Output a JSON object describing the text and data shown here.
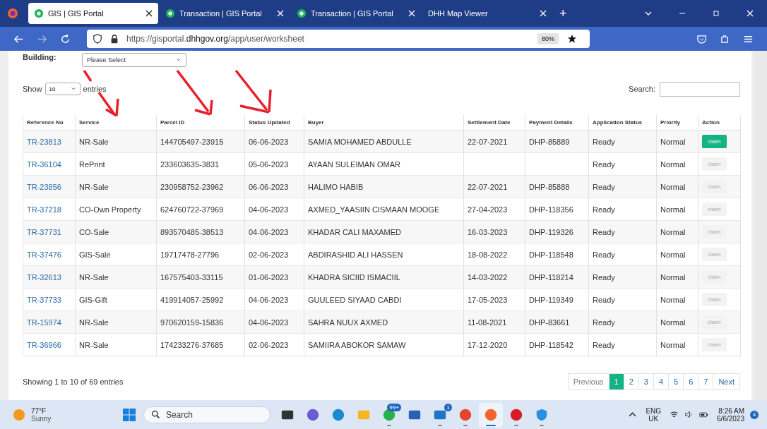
{
  "browser": {
    "tabs": [
      {
        "title": "GIS | GIS Portal",
        "selected": true,
        "kind": "gis"
      },
      {
        "title": "Transaction | GIS Portal",
        "selected": false,
        "kind": "gis"
      },
      {
        "title": "Transaction | GIS Portal",
        "selected": false,
        "kind": "gis"
      },
      {
        "title": "DHH Map Viewer",
        "selected": false,
        "kind": "plain"
      }
    ],
    "new_tab": "+",
    "url_prefix": "https://gisportal.",
    "url_domain": "dhhgov.org",
    "url_path": "/app/user/worksheet",
    "zoom": "80%"
  },
  "filters": {
    "building_label": "Building:",
    "building_select": "Please Select",
    "show_label": "Show",
    "page_length": "10",
    "entries_label": "entries",
    "search_label": "Search:"
  },
  "table": {
    "columns": [
      "Reference No",
      "Service",
      "Parcel ID",
      "Status Updated",
      "Buyer",
      "Settlement Date",
      "Payment Details",
      "Application Status",
      "Priority",
      "Action"
    ],
    "rows": [
      {
        "ref": "TR-23813",
        "service": "NR-Sale",
        "parcel": "144705497-23915",
        "status_updated": "06-06-2023",
        "buyer": "SAMIA MOHAMED ABDULLE",
        "settlement": "22-07-2021",
        "payment": "DHP-85889",
        "app_status": "Ready",
        "priority": "Normal",
        "action": "claim",
        "disabled": false
      },
      {
        "ref": "TR-36104",
        "service": "RePrint",
        "parcel": "233603635-3831",
        "status_updated": "05-06-2023",
        "buyer": "AYAAN SULEIMAN OMAR",
        "settlement": "",
        "payment": "",
        "app_status": "Ready",
        "priority": "Normal",
        "action": "claim",
        "disabled": true
      },
      {
        "ref": "TR-23856",
        "service": "NR-Sale",
        "parcel": "230958752-23962",
        "status_updated": "06-06-2023",
        "buyer": "HALIMO HABIB",
        "settlement": "22-07-2021",
        "payment": "DHP-85888",
        "app_status": "Ready",
        "priority": "Normal",
        "action": "claim",
        "disabled": true
      },
      {
        "ref": "TR-37218",
        "service": "CO-Own Property",
        "parcel": "624760722-37969",
        "status_updated": "04-06-2023",
        "buyer": "AXMED_YAASIIN CISMAAN MOOGE",
        "settlement": "27-04-2023",
        "payment": "DHP-118356",
        "app_status": "Ready",
        "priority": "Normal",
        "action": "claim",
        "disabled": true
      },
      {
        "ref": "TR-37731",
        "service": "CO-Sale",
        "parcel": "893570485-38513",
        "status_updated": "04-06-2023",
        "buyer": "KHADAR CALI MAXAMED",
        "settlement": "16-03-2023",
        "payment": "DHP-119326",
        "app_status": "Ready",
        "priority": "Normal",
        "action": "claim",
        "disabled": true
      },
      {
        "ref": "TR-37476",
        "service": "GIS-Sale",
        "parcel": "19717478-27796",
        "status_updated": "02-06-2023",
        "buyer": "ABDIRASHID ALI HASSEN",
        "settlement": "18-08-2022",
        "payment": "DHP-118548",
        "app_status": "Ready",
        "priority": "Normal",
        "action": "claim",
        "disabled": true
      },
      {
        "ref": "TR-32613",
        "service": "NR-Sale",
        "parcel": "167575403-33115",
        "status_updated": "01-06-2023",
        "buyer": "KHADRA SICIID ISMACIIL",
        "settlement": "14-03-2022",
        "payment": "DHP-118214",
        "app_status": "Ready",
        "priority": "Normal",
        "action": "claim",
        "disabled": true
      },
      {
        "ref": "TR-37733",
        "service": "GIS-Gift",
        "parcel": "419914057-25992",
        "status_updated": "04-06-2023",
        "buyer": "GUULEED SIYAAD CABDI",
        "settlement": "17-05-2023",
        "payment": "DHP-119349",
        "app_status": "Ready",
        "priority": "Normal",
        "action": "claim",
        "disabled": true
      },
      {
        "ref": "TR-15974",
        "service": "NR-Sale",
        "parcel": "970620159-15836",
        "status_updated": "04-06-2023",
        "buyer": "SAHRA NUUX AXMED",
        "settlement": "11-08-2021",
        "payment": "DHP-83661",
        "app_status": "Ready",
        "priority": "Normal",
        "action": "claim",
        "disabled": true
      },
      {
        "ref": "TR-36966",
        "service": "NR-Sale",
        "parcel": "174233276-37685",
        "status_updated": "02-06-2023",
        "buyer": "SAMIIRA ABOKOR SAMAW",
        "settlement": "17-12-2020",
        "payment": "DHP-118542",
        "app_status": "Ready",
        "priority": "Normal",
        "action": "claim",
        "disabled": true
      }
    ]
  },
  "info": "Showing 1 to 10 of 69 entries",
  "pagination": {
    "previous": "Previous",
    "previous_disabled": true,
    "pages": [
      {
        "label": "1",
        "selected": true
      },
      {
        "label": "2",
        "selected": false
      },
      {
        "label": "3",
        "selected": false
      },
      {
        "label": "4",
        "selected": false
      },
      {
        "label": "5",
        "selected": false
      },
      {
        "label": "6",
        "selected": false
      },
      {
        "label": "7",
        "selected": false
      }
    ],
    "next": "Next"
  },
  "taskbar": {
    "temperature": "77°F",
    "condition": "Sunny",
    "search_placeholder": "Search",
    "apps": [
      {
        "kind": "files-stack",
        "running": false,
        "active": false
      },
      {
        "kind": "chat",
        "running": false,
        "active": false
      },
      {
        "kind": "edge",
        "running": false,
        "active": false
      },
      {
        "kind": "folder",
        "running": false,
        "active": false
      },
      {
        "kind": "whatsapp",
        "badge": "99+",
        "running": true,
        "active": false
      },
      {
        "kind": "word",
        "running": false,
        "active": false
      },
      {
        "kind": "mail",
        "badge": "1",
        "running": true,
        "active": false
      },
      {
        "kind": "chrome",
        "running": true,
        "active": false
      },
      {
        "kind": "firefox",
        "running": true,
        "active": true
      },
      {
        "kind": "opera",
        "running": true,
        "active": false
      },
      {
        "kind": "shield",
        "running": true,
        "active": false
      }
    ],
    "language": "ENG",
    "region": "UK",
    "time": "8:26 AM",
    "date": "6/6/2023",
    "notifications": "4"
  }
}
